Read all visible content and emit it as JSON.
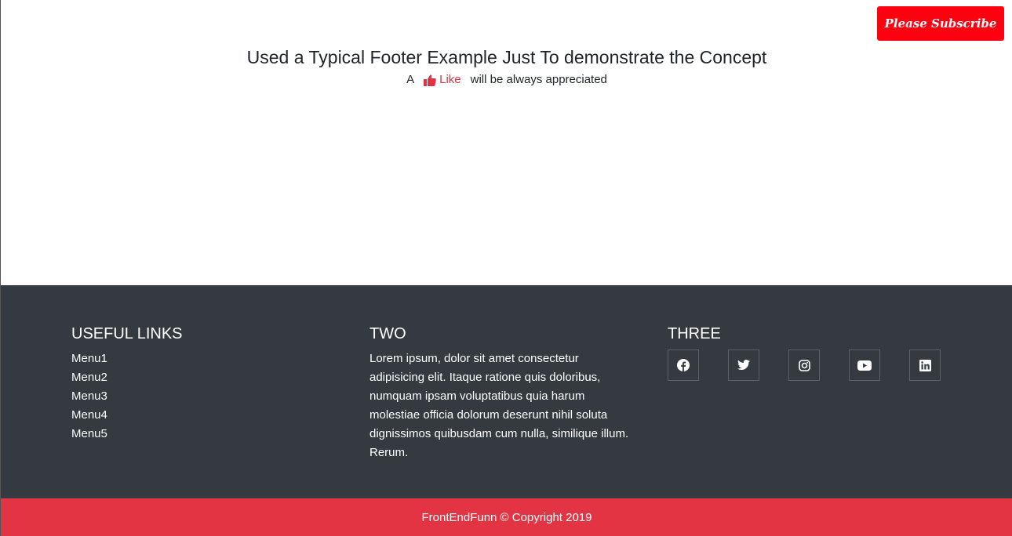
{
  "subscribe": {
    "label": "Please Subscribe"
  },
  "hero": {
    "title": "Used a Typical Footer Example Just To demonstrate the Concept",
    "prefix": "A",
    "like_label": "Like",
    "suffix": "will be always appreciated"
  },
  "footer": {
    "col1": {
      "heading": "USEFUL LINKS",
      "items": [
        "Menu1",
        "Menu2",
        "Menu3",
        "Menu4",
        "Menu5"
      ]
    },
    "col2": {
      "heading": "TWO",
      "text": "Lorem ipsum, dolor sit amet consectetur adipisicing elit. Itaque ratione quis doloribus, numquam ipsam voluptatibus quia harum molestiae officia dolorum deserunt nihil soluta dignissimos quibusdam cum nulla, similique illum. Rerum."
    },
    "col3": {
      "heading": "THREE",
      "socials": [
        "facebook-icon",
        "twitter-icon",
        "instagram-icon",
        "youtube-icon",
        "linkedin-icon"
      ]
    }
  },
  "copyright": "FrontEndFunn © Copyright 2019",
  "colors": {
    "subscribe_bg": "#ff0011",
    "like": "#dc3545",
    "footer_bg": "#343a40",
    "bottom_bar_bg": "#e33444"
  }
}
